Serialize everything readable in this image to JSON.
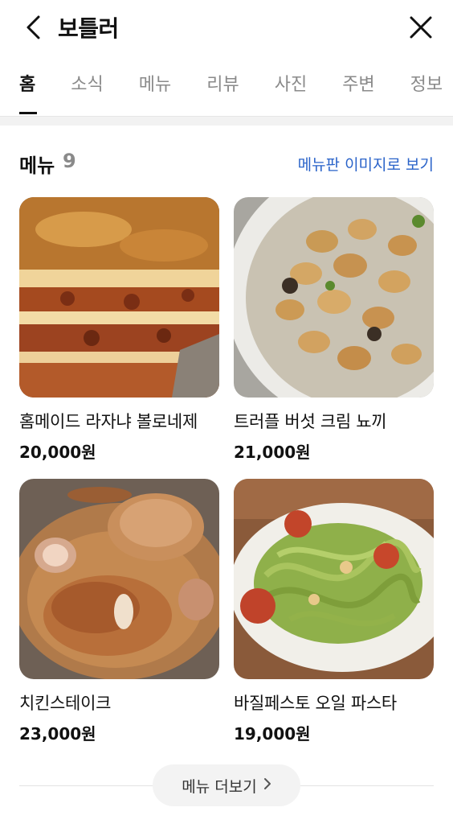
{
  "header": {
    "title": "보틀러"
  },
  "tabs": [
    {
      "label": "홈"
    },
    {
      "label": "소식"
    },
    {
      "label": "메뉴"
    },
    {
      "label": "리뷰"
    },
    {
      "label": "사진"
    },
    {
      "label": "주변"
    },
    {
      "label": "정보"
    }
  ],
  "section": {
    "title": "메뉴",
    "count": "9",
    "menu_image_link": "메뉴판 이미지로 보기"
  },
  "menu_items": [
    {
      "name": "홈메이드 라자냐 볼로네제",
      "price": "20,000원"
    },
    {
      "name": "트러플 버섯 크림 뇨끼",
      "price": "21,000원"
    },
    {
      "name": "치킨스테이크",
      "price": "23,000원"
    },
    {
      "name": "바질페스토 오일 파스타",
      "price": "19,000원"
    }
  ],
  "more_button": {
    "label": "메뉴 더보기"
  },
  "colors": {
    "link": "#2a63c9",
    "muted": "#8a8a8a"
  }
}
